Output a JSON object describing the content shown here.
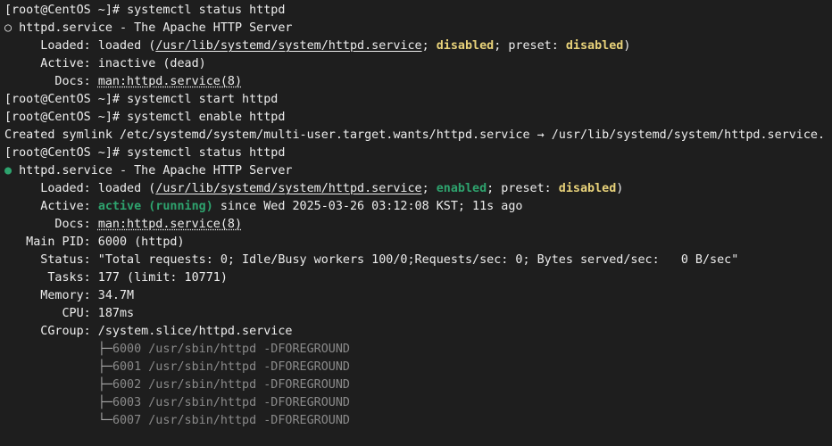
{
  "colors": {
    "background": "#1e1e1e",
    "foreground": "#ededed",
    "enabled": "#2ea36e",
    "disabled": "#e8d27a",
    "dim": "#8a8a8a"
  },
  "prompt": "[root@CentOS ~]# ",
  "cmd1": "systemctl status httpd",
  "status1": {
    "circle": "○",
    "unit": " httpd.service - The Apache HTTP Server",
    "loaded_key": "     Loaded: ",
    "loaded_pre": "loaded (",
    "unit_path": "/usr/lib/systemd/system/httpd.service",
    "sep1": "; ",
    "state": "disabled",
    "sep2": "; preset: ",
    "preset": "disabled",
    "close": ")",
    "active_key": "     Active: ",
    "active_val": "inactive (dead)",
    "docs_key": "       Docs: ",
    "docs_val": "man:httpd.service(8)"
  },
  "cmd2": "systemctl start httpd",
  "cmd3": "systemctl enable httpd",
  "symlink": "Created symlink /etc/systemd/system/multi-user.target.wants/httpd.service → /usr/lib/systemd/system/httpd.service.",
  "cmd4": "systemctl status httpd",
  "status2": {
    "dot": "●",
    "unit": " httpd.service - The Apache HTTP Server",
    "loaded_key": "     Loaded: ",
    "loaded_pre": "loaded (",
    "unit_path": "/usr/lib/systemd/system/httpd.service",
    "sep1": "; ",
    "state": "enabled",
    "sep2": "; preset: ",
    "preset": "disabled",
    "close": ")",
    "active_key": "     Active: ",
    "active_state": "active (running)",
    "active_since": " since Wed 2025-03-26 03:12:08 KST; 11s ago",
    "docs_key": "       Docs: ",
    "docs_val": "man:httpd.service(8)",
    "mainpid": "   Main PID: 6000 (httpd)",
    "status": "     Status: \"Total requests: 0; Idle/Busy workers 100/0;Requests/sec: 0; Bytes served/sec:   0 B/sec\"",
    "tasks": "      Tasks: 177 (limit: 10771)",
    "memory": "     Memory: 34.7M",
    "cpu": "        CPU: 187ms",
    "cgroup": "     CGroup: /system.slice/httpd.service",
    "tree_indent": "             ",
    "processes": [
      {
        "branch": "├─",
        "text": "6000 /usr/sbin/httpd -DFOREGROUND"
      },
      {
        "branch": "├─",
        "text": "6001 /usr/sbin/httpd -DFOREGROUND"
      },
      {
        "branch": "├─",
        "text": "6002 /usr/sbin/httpd -DFOREGROUND"
      },
      {
        "branch": "├─",
        "text": "6003 /usr/sbin/httpd -DFOREGROUND"
      },
      {
        "branch": "└─",
        "text": "6007 /usr/sbin/httpd -DFOREGROUND"
      }
    ]
  }
}
